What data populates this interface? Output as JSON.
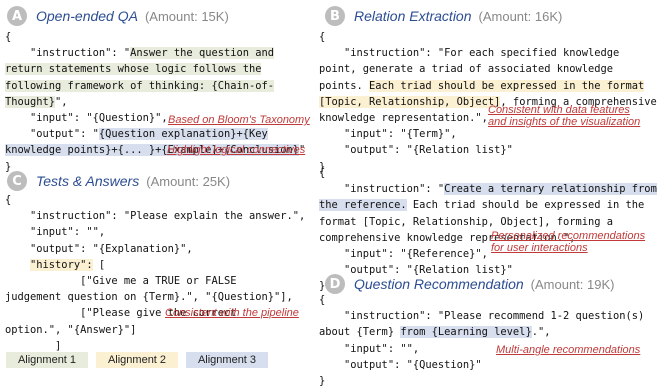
{
  "colors": {
    "alignment_1": "#e8ecdc",
    "alignment_2": "#fbf0d2",
    "alignment_3": "#d7deed",
    "annotation": "#c03a3a",
    "panel_title": "#2c4d93",
    "badge": "#bdbdbd"
  },
  "panels": {
    "A": {
      "badge": "A",
      "title": "Open-ended QA",
      "amount": "(Amount: 15K)",
      "code": {
        "l1": "{",
        "l2a": "    \"instruction\": \"",
        "l2b": "Answer the question and",
        "l3": "return statements whose logic follows the",
        "l4": "following framework of thinking: {Chain-of-",
        "l5a": "Thought}",
        "l5b": "\",",
        "l6": "    \"input\": \"{Question}\",",
        "l7a": "    \"output\": \"",
        "l7b": "{Question explanation}+{Key",
        "l8a": "knowledge points}+{... }+{Example}+{Conclusion}",
        "l8b": "\"",
        "l9": "}"
      },
      "notes": [
        "Based on Bloom's Taxonomy",
        "Highlight logical connectives"
      ]
    },
    "B": {
      "badge": "B",
      "title": "Relation Extraction",
      "amount": "(Amount: 16K)",
      "code1": {
        "l1": "{",
        "l2": "    \"instruction\": \"For each specified knowledge",
        "l3": "point, generate a triad of associated knowledge",
        "l4a": "points. ",
        "l4b": "Each triad should be expressed in the format",
        "l5a": "[Topic, Relationship, Object]",
        "l5b": ", forming a comprehensive",
        "l6": "knowledge representation.\",",
        "l7": "    \"input\": \"{Term}\",",
        "l8": "    \"output\": \"{Relation list}\"",
        "l9": "}"
      },
      "code2": {
        "l1": "{",
        "l2a": "    \"instruction\": \"",
        "l2b": "Create a ternary relationship from",
        "l3a": "the reference.",
        "l3b": " Each triad should be expressed in the",
        "l4": "format [Topic, Relationship, Object], forming a",
        "l5": "comprehensive knowledge representation.\",",
        "l6": "    \"input\": \"{Reference}\",",
        "l7": "    \"output\": \"{Relation list}\"",
        "l8": "}"
      },
      "notes": [
        "Consistent with data features",
        "and insights of the visualization",
        "Personalized recommendations",
        "for user interactions"
      ]
    },
    "C": {
      "badge": "C",
      "title": "Tests & Answers",
      "amount": "(Amount: 25K)",
      "code": {
        "l1": "{",
        "l2": "    \"instruction\": \"Please explain the answer.\",",
        "l3": "    \"input\": \"\",",
        "l4": "    \"output\": \"{Explanation}\",",
        "l5a": "    ",
        "l5b": "\"history\":",
        "l5c": " [",
        "l6": "            [\"Give me a TRUE or FALSE",
        "l7": "judgement question on {Term}.\", \"{Question}\"],",
        "l8": "            [\"Please give the correct",
        "l9": "option.\", \"{Answer}\"]",
        "l10": "        ]",
        "l11": "}"
      },
      "notes": [
        "Consistent with the pipeline"
      ]
    },
    "D": {
      "badge": "D",
      "title": "Question Recommendation",
      "amount": "(Amount: 19K)",
      "code": {
        "l1": "{",
        "l2": "    \"instruction\": \"Please recommend 1-2 question(s)",
        "l3a": "about {Term} ",
        "l3b": "from {Learning level}",
        "l3c": ".\",",
        "l4": "    \"input\": \"\",",
        "l5": "    \"output\": \"{Question}\"",
        "l6": "}"
      },
      "notes": [
        "Multi-angle recommendations"
      ]
    }
  },
  "legend": [
    "Alignment 1",
    "Alignment 2",
    "Alignment 3"
  ]
}
